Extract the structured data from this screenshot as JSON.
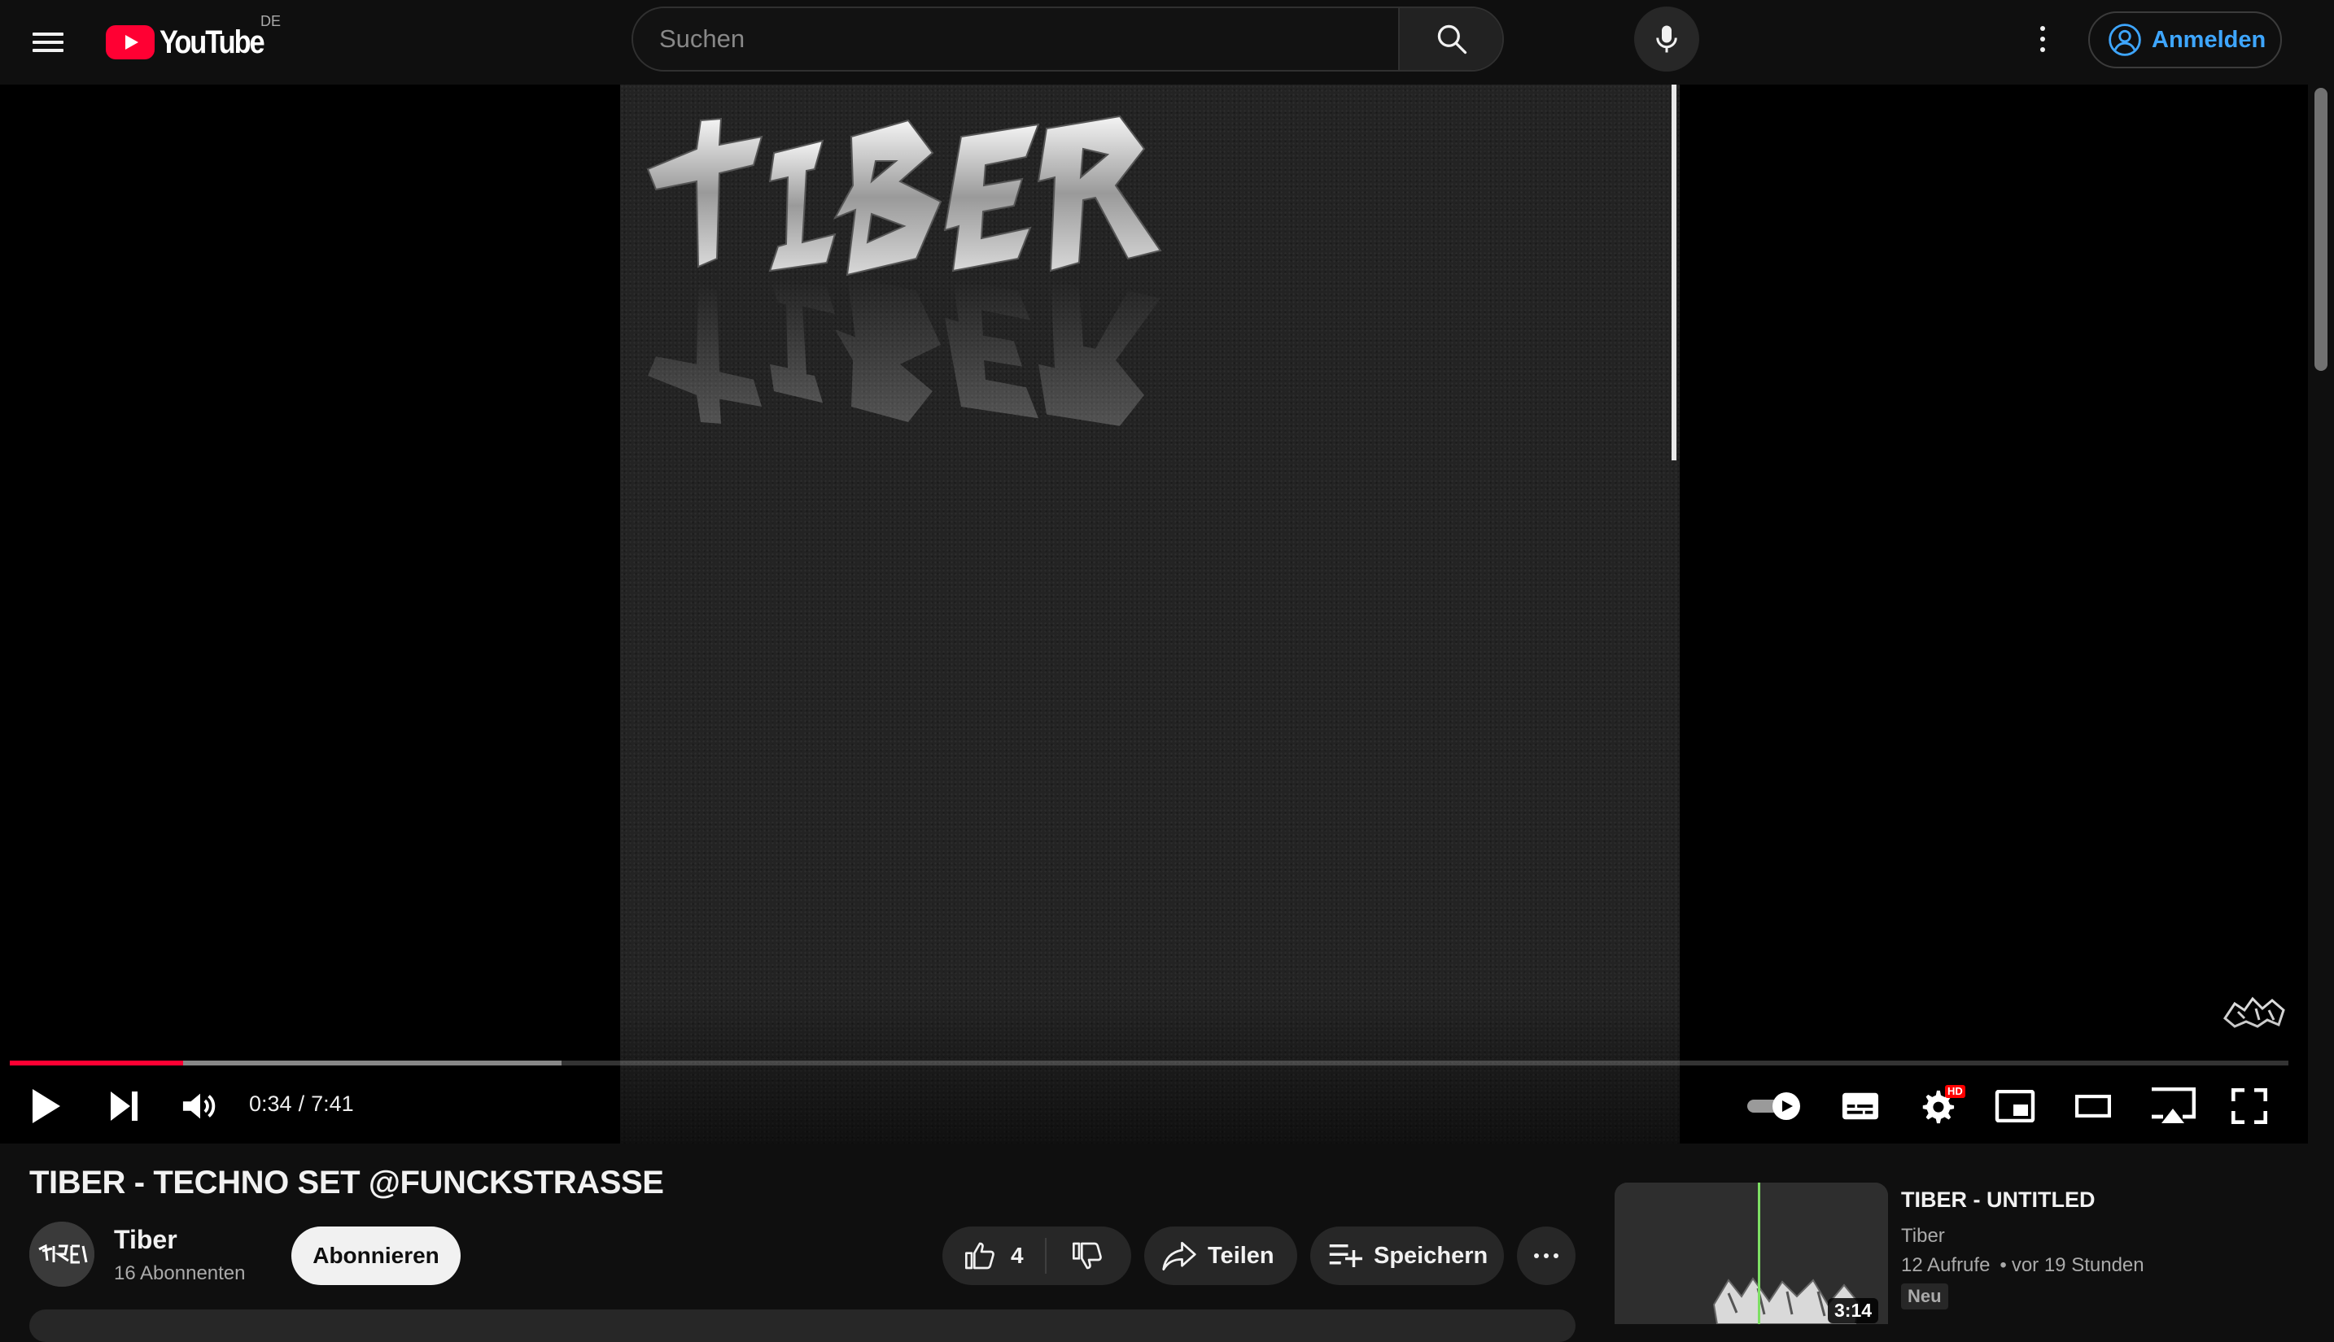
{
  "masthead": {
    "logo_text": "YouTube",
    "country_code": "DE",
    "search_placeholder": "Suchen",
    "signin_label": "Anmelden",
    "icons": [
      "menu-icon",
      "youtube-logo-icon",
      "search-icon",
      "mic-icon",
      "more-vertical-icon",
      "account-icon"
    ]
  },
  "player": {
    "current_time": "0:34",
    "separator": "/",
    "duration": "7:41",
    "progress_played_fraction": 0.076,
    "progress_buffered_fraction": 0.242,
    "video_text_art": "TIBER",
    "watermark_text": "TIBER",
    "settings_badge": "HD",
    "autoplay_on": true,
    "colors": {
      "progress_played": "#ff0033",
      "frame_line": "#e8e8e8"
    },
    "icons": [
      "play-icon",
      "next-icon",
      "volume-icon",
      "autoplay-toggle-icon",
      "subtitles-icon",
      "settings-icon",
      "miniplayer-icon",
      "theater-mode-icon",
      "cast-icon",
      "fullscreen-icon"
    ]
  },
  "video": {
    "title": "TIBER - TECHNO SET @FUNCKSTRASSE",
    "channel_name": "Tiber",
    "channel_avatar_text": "TIBER",
    "subscriber_count": "16 Abonnenten",
    "subscribe_label": "Abonnieren",
    "like_count": "4",
    "share_label": "Teilen",
    "save_label": "Speichern"
  },
  "recommendation": {
    "title": "TIBER - UNTITLED",
    "channel": "Tiber",
    "views": "12 Aufrufe",
    "dot": "•",
    "age": "vor 19 Stunden",
    "badge": "Neu",
    "duration": "3:14",
    "thumb_text": "TIBER"
  }
}
